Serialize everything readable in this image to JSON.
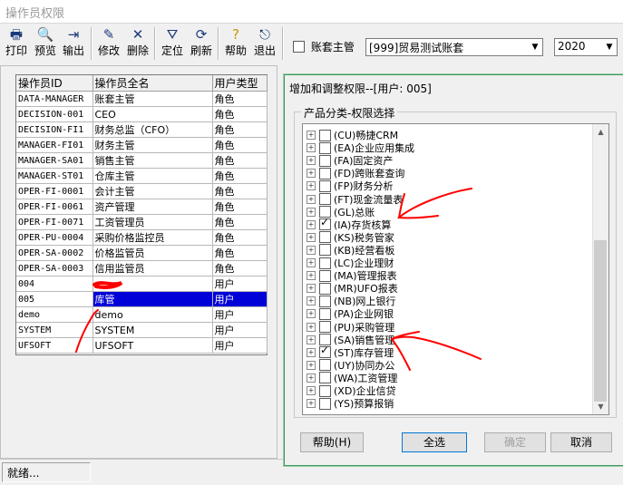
{
  "window": {
    "title": "操作员权限"
  },
  "toolbar": {
    "print": "打印",
    "preview": "预览",
    "export": "输出",
    "edit": "修改",
    "delete": "删除",
    "locate": "定位",
    "refresh": "刷新",
    "help": "帮助",
    "exit": "退出",
    "account_manager": "账套主管",
    "account_set": "[999]贸易测试账套",
    "year": "2020"
  },
  "operators": {
    "headers": [
      "操作员ID",
      "操作员全名",
      "用户类型"
    ],
    "rows": [
      [
        "DATA-MANAGER",
        "账套主管",
        "角色"
      ],
      [
        "DECISION-001",
        "CEO",
        "角色"
      ],
      [
        "DECISION-FI1",
        "财务总监（CFO）",
        "角色"
      ],
      [
        "MANAGER-FI01",
        "财务主管",
        "角色"
      ],
      [
        "MANAGER-SA01",
        "销售主管",
        "角色"
      ],
      [
        "MANAGER-ST01",
        "仓库主管",
        "角色"
      ],
      [
        "OPER-FI-0001",
        "会计主管",
        "角色"
      ],
      [
        "OPER-FI-0061",
        "资产管理",
        "角色"
      ],
      [
        "OPER-FI-0071",
        "工资管理员",
        "角色"
      ],
      [
        "OPER-PU-0004",
        "采购价格监控员",
        "角色"
      ],
      [
        "OPER-SA-0002",
        "价格监管员",
        "角色"
      ],
      [
        "OPER-SA-0003",
        "信用监管员",
        "角色"
      ],
      [
        "004",
        "",
        "用户"
      ],
      [
        "005",
        "库管",
        "用户"
      ],
      [
        "demo",
        "demo",
        "用户"
      ],
      [
        "SYSTEM",
        "SYSTEM",
        "用户"
      ],
      [
        "UFSOFT",
        "UFSOFT",
        "用户"
      ]
    ]
  },
  "status": {
    "text": "就绪..."
  },
  "dialog": {
    "title": "增加和调整权限--[用户: 005]",
    "group_label": "产品分类-权限选择",
    "items": [
      {
        "label": "(CU)畅捷CRM",
        "checked": false
      },
      {
        "label": "(EA)企业应用集成",
        "checked": false
      },
      {
        "label": "(FA)固定资产",
        "checked": false
      },
      {
        "label": "(FD)跨账套查询",
        "checked": false
      },
      {
        "label": "(FP)财务分析",
        "checked": false
      },
      {
        "label": "(FT)现金流量表",
        "checked": false
      },
      {
        "label": "(GL)总账",
        "checked": false
      },
      {
        "label": "(IA)存货核算",
        "checked": true
      },
      {
        "label": "(KS)税务管家",
        "checked": false
      },
      {
        "label": "(KB)经营看板",
        "checked": false
      },
      {
        "label": "(LC)企业理财",
        "checked": false
      },
      {
        "label": "(MA)管理报表",
        "checked": false
      },
      {
        "label": "(MR)UFO报表",
        "checked": false
      },
      {
        "label": "(NB)网上银行",
        "checked": false
      },
      {
        "label": "(PA)企业网银",
        "checked": false
      },
      {
        "label": "(PU)采购管理",
        "checked": false
      },
      {
        "label": "(SA)销售管理",
        "checked": false
      },
      {
        "label": "(ST)库存管理",
        "checked": true
      },
      {
        "label": "(UY)协同办公",
        "checked": false
      },
      {
        "label": "(WA)工资管理",
        "checked": false
      },
      {
        "label": "(XD)企业信贷",
        "checked": false
      },
      {
        "label": "(YS)预算报销",
        "checked": false
      }
    ],
    "buttons": {
      "help": "帮助(H)",
      "select_all": "全选",
      "ok": "确定",
      "cancel": "取消"
    }
  },
  "colors": {
    "selection": "#0000d8",
    "annotation": "#ff0000",
    "dialog_border": "#3c9a5a"
  }
}
